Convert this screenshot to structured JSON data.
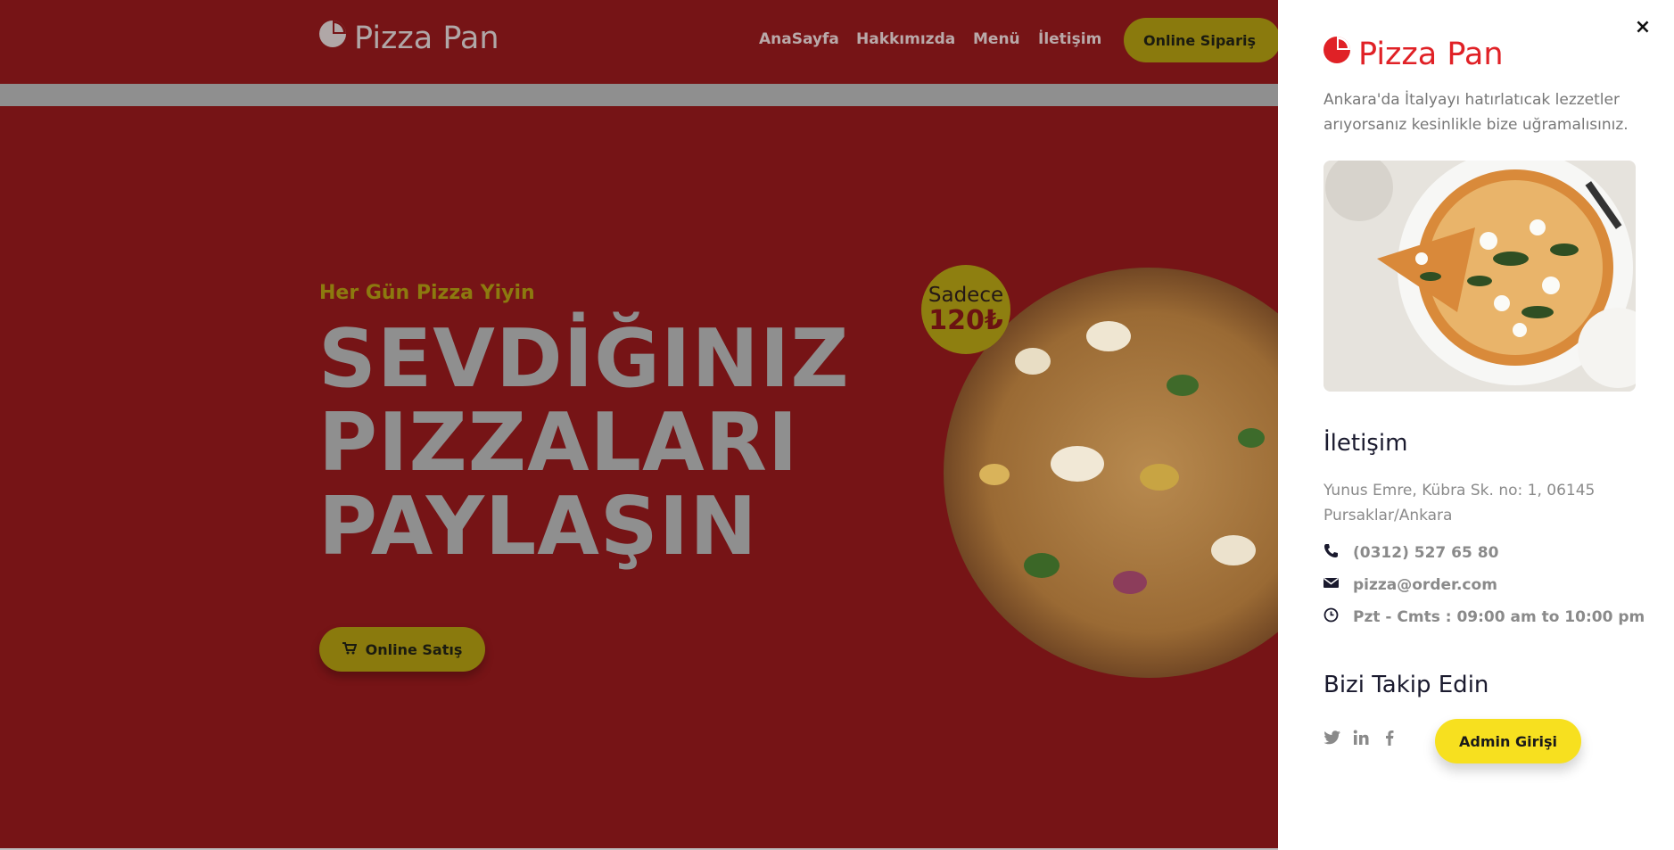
{
  "header": {
    "logo_text": "Pizza Pan",
    "nav": [
      "AnaSayfa",
      "Hakkımızda",
      "Menü",
      "İletişim"
    ],
    "order_button": "Online Sipariş"
  },
  "hero": {
    "tagline": "Her Gün Pizza Yiyin",
    "headline": [
      "SEVDİĞINIZ",
      "PIZZALARI",
      "PAYLAŞIN"
    ],
    "sale_button": "Online Satış",
    "badge_line1": "Sadece",
    "badge_line2": "120₺"
  },
  "panel": {
    "logo_text": "Pizza Pan",
    "description": "Ankara'da İtalyayı hatırlatıcak lezzetler arıyorsanız kesinlikle bize uğramalısınız.",
    "contact_title": "İletişim",
    "address": "Yunus Emre, Kübra Sk. no: 1, 06145 Pursaklar/Ankara",
    "phone": "(0312) 527 65 80",
    "email": "pizza@order.com",
    "hours": "Pzt - Cmts : 09:00 am to 10:00 pm",
    "follow_title": "Bizi Takip Edin",
    "admin_button": "Admin Girişi",
    "close_symbol": "×"
  },
  "colors": {
    "brand_red": "#761416",
    "accent_yellow": "#f7e01f",
    "logo_red": "#e02126"
  },
  "icons": {
    "logo": "pizza-slice-icon",
    "cart": "cart-icon",
    "phone": "phone-icon",
    "email": "envelope-icon",
    "hours": "clock-icon",
    "social": [
      "twitter-icon",
      "linkedin-icon",
      "facebook-icon"
    ]
  }
}
